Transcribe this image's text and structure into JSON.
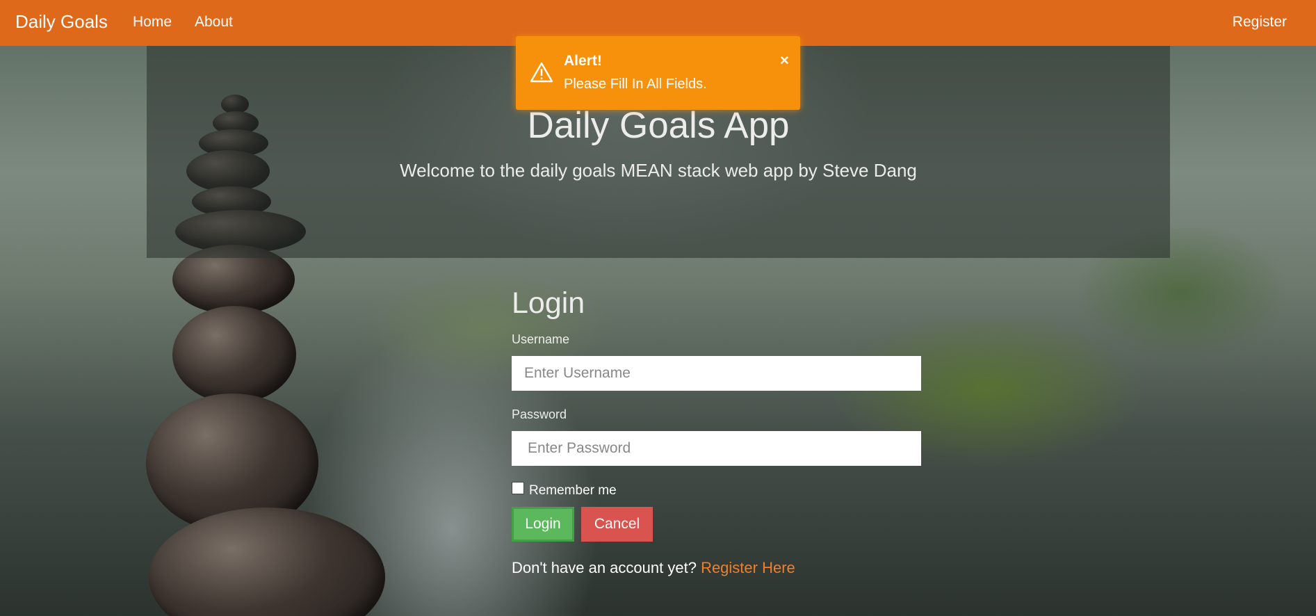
{
  "navbar": {
    "brand": "Daily Goals",
    "links": [
      "Home",
      "About"
    ],
    "register": "Register",
    "color": "#df691a"
  },
  "alert": {
    "title": "Alert!",
    "message": "Please Fill In All Fields.",
    "close": "×",
    "color": "#f7910b",
    "icon": "warning-triangle-icon"
  },
  "jumbotron": {
    "title": "Daily Goals App",
    "subtitle": "Welcome to the daily goals MEAN stack web app by Steve Dang"
  },
  "login": {
    "heading": "Login",
    "username_label": "Username",
    "username_value": "",
    "username_placeholder": "Enter Username",
    "password_label": "Password",
    "password_value": "",
    "password_placeholder": "Enter Password",
    "remember_label": "Remember me",
    "remember_checked": false,
    "login_button": "Login",
    "cancel_button": "Cancel",
    "signup_prompt": "Don't have an account yet?",
    "signup_link": "Register Here"
  },
  "colors": {
    "login_button": "#5cb85c",
    "cancel_button": "#d9534f",
    "link": "#f07f2a"
  }
}
